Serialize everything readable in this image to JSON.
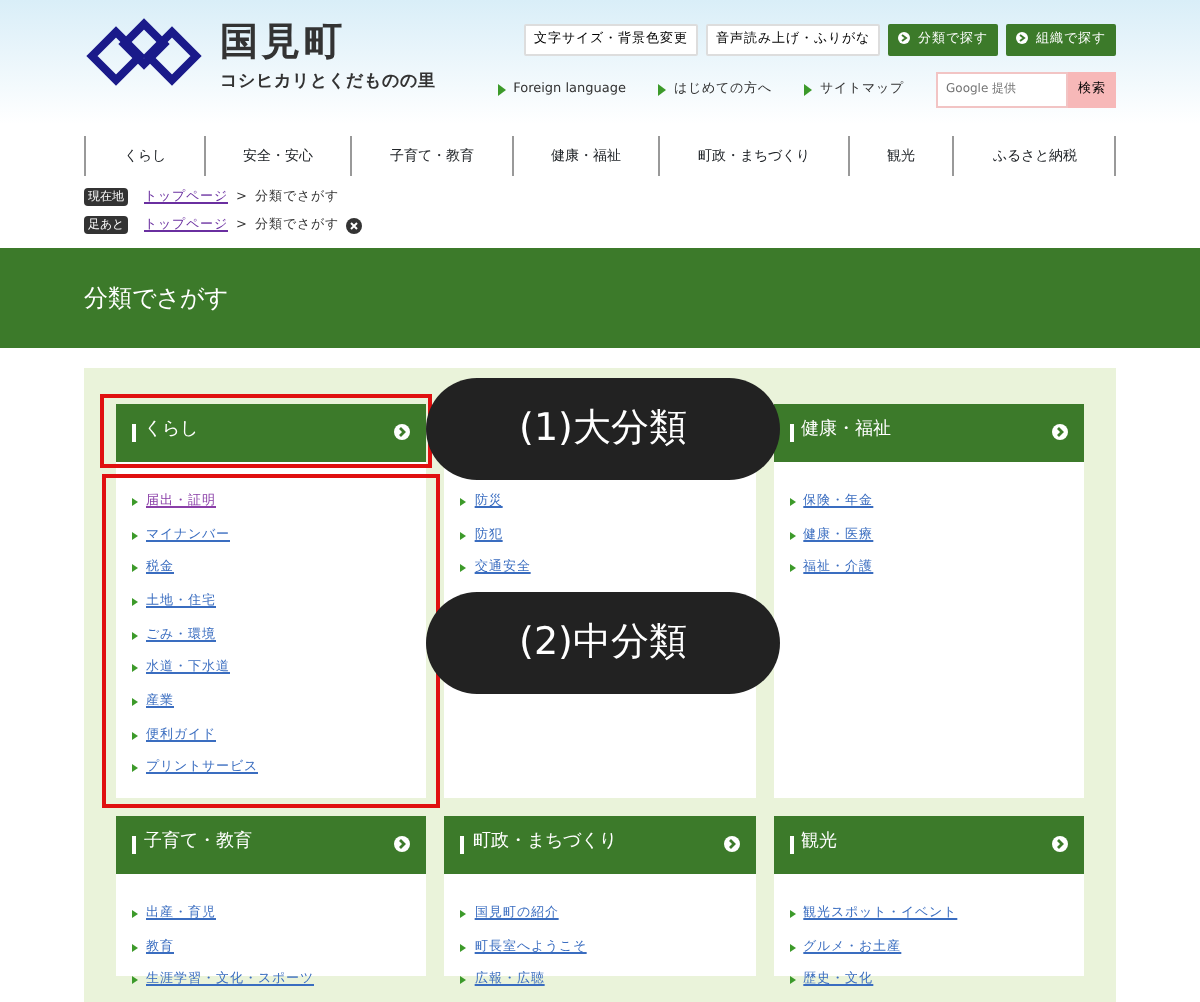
{
  "site": {
    "name": "国見町",
    "tagline": "コシヒカリとくだものの里"
  },
  "utility_buttons": [
    {
      "label": "文字サイズ・背景色変更",
      "kind": "plain"
    },
    {
      "label": "音声読み上げ・ふりがな",
      "kind": "plain"
    },
    {
      "label": "分類で探す",
      "kind": "green"
    },
    {
      "label": "組織で探す",
      "kind": "green"
    }
  ],
  "utility_links": [
    "Foreign language",
    "はじめての方へ",
    "サイトマップ"
  ],
  "search": {
    "placeholder": "Google 提供",
    "button": "検索"
  },
  "global_nav": [
    "くらし",
    "安全・安心",
    "子育て・教育",
    "健康・福祉",
    "町政・まちづくり",
    "観光",
    "ふるさと納税"
  ],
  "breadcrumbs": [
    {
      "badge": "現在地",
      "link": "トップページ",
      "separator": ">",
      "current": "分類でさがす",
      "closable": false
    },
    {
      "badge": "足あと",
      "link": "トップページ",
      "separator": ">",
      "current": "分類でさがす",
      "closable": true
    }
  ],
  "page_title": "分類でさがす",
  "categories": [
    {
      "title": "くらし",
      "items": [
        {
          "label": "届出・証明",
          "visited": true
        },
        {
          "label": "マイナンバー",
          "visited": false
        },
        {
          "label": "税金",
          "visited": false
        },
        {
          "label": "土地・住宅",
          "visited": false
        },
        {
          "label": "ごみ・環境",
          "visited": false
        },
        {
          "label": "水道・下水道",
          "visited": false
        },
        {
          "label": "産業",
          "visited": false
        },
        {
          "label": "便利ガイド",
          "visited": false
        },
        {
          "label": "プリントサービス",
          "visited": false
        }
      ]
    },
    {
      "items": [
        {
          "label": "防災",
          "visited": false
        },
        {
          "label": "防犯",
          "visited": false
        },
        {
          "label": "交通安全",
          "visited": false
        }
      ]
    },
    {
      "title": "健康・福祉",
      "items": [
        {
          "label": "保険・年金",
          "visited": false
        },
        {
          "label": "健康・医療",
          "visited": false
        },
        {
          "label": "福祉・介護",
          "visited": false
        }
      ]
    },
    {
      "title": "子育て・教育",
      "items": [
        {
          "label": "出産・育児",
          "visited": false
        },
        {
          "label": "教育",
          "visited": false
        },
        {
          "label": "生涯学習・文化・スポーツ",
          "visited": false
        }
      ]
    },
    {
      "title": "町政・まちづくり",
      "items": [
        {
          "label": "国見町の紹介",
          "visited": false
        },
        {
          "label": "町長室へようこそ",
          "visited": false
        },
        {
          "label": "広報・広聴",
          "visited": false
        }
      ]
    },
    {
      "title": "観光",
      "items": [
        {
          "label": "観光スポット・イベント",
          "visited": false
        },
        {
          "label": "グルメ・お土産",
          "visited": false
        },
        {
          "label": "歴史・文化",
          "visited": false
        }
      ]
    }
  ],
  "callouts": [
    {
      "label": "(1)大分類"
    },
    {
      "label": "(2)中分類"
    }
  ]
}
